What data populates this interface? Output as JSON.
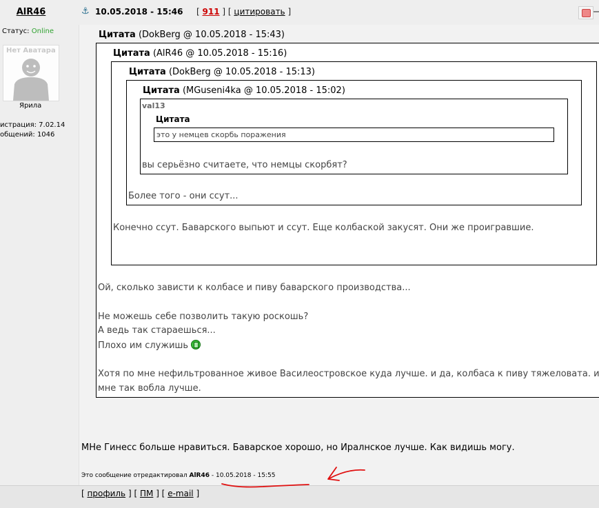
{
  "post": {
    "author": "AlR46",
    "date": "10.05.2018 - 15:46",
    "bracket_open": "[",
    "bracket_mid": "] [",
    "bracket_close": "]",
    "post_number": "911",
    "quote_link": "цитировать"
  },
  "profile": {
    "status_label": "Статус:",
    "status_value": "Online",
    "avatar_text": "Нет Аватара",
    "rank": "Ярила",
    "registration": "истрация: 7.02.14",
    "messages": "общений: 1046"
  },
  "quotes": {
    "q1_header_bold": "Цитата",
    "q1_header_meta": "(DokBerg @ 10.05.2018 - 15:43)",
    "q2_header_bold": "Цитата",
    "q2_header_meta": "(AlR46 @ 10.05.2018 - 15:16)",
    "q3_header_bold": "Цитата",
    "q3_header_meta": "(DokBerg @ 10.05.2018 - 15:13)",
    "q4_header_bold": "Цитата",
    "q4_header_meta": "(MGuseni4ka @ 10.05.2018 - 15:02)",
    "q5_author": "val13",
    "q5_inner_header": "Цитата",
    "q5_inner_text": "это у немцев скорбь поражения",
    "q5_text": "вы серьёзно считаете, что немцы скорбят?",
    "q4_text": "Более того - они ссут...",
    "q3_text": "Конечно ссут. Баварского выпьют и ссут. Еще колбаской закусят. Они же проигравшие.",
    "q2_line1": "Ой, сколько зависти к колбасе и пиву баварского производства...",
    "q2_line2": "Не можешь себе позволить такую роскошь?",
    "q2_line3": "А ведь так стараешься...",
    "q2_line4": "Плохо им служишь",
    "q2_line5": "Хотя по мне нефильтрованное живое Василеостровское куда лучше. и да, колбаса к пиву тяжеловата. и",
    "q2_line6": "мне так вобла лучше."
  },
  "body": {
    "text": "МНе Гинесс больше нравиться. Баварское хорошо, но Иралнское лучше. Как видишь могу.",
    "edited_prefix": "Это сообщение отредактировал",
    "edited_author": "AlR46",
    "edited_suffix": "- 10.05.2018 - 15:55"
  },
  "footer": {
    "profile": "профиль",
    "pm": "ПМ",
    "email": "e-mail",
    "sep_open": "[",
    "sep_mid": "] [",
    "sep_close": "]"
  },
  "colors": {
    "online": "#2ea12e",
    "post_number": "#cc0000",
    "annotation": "#e01010"
  },
  "icons": {
    "anchor": "anchor-icon",
    "report": "report-icon",
    "smiley": "smiley-icon"
  }
}
